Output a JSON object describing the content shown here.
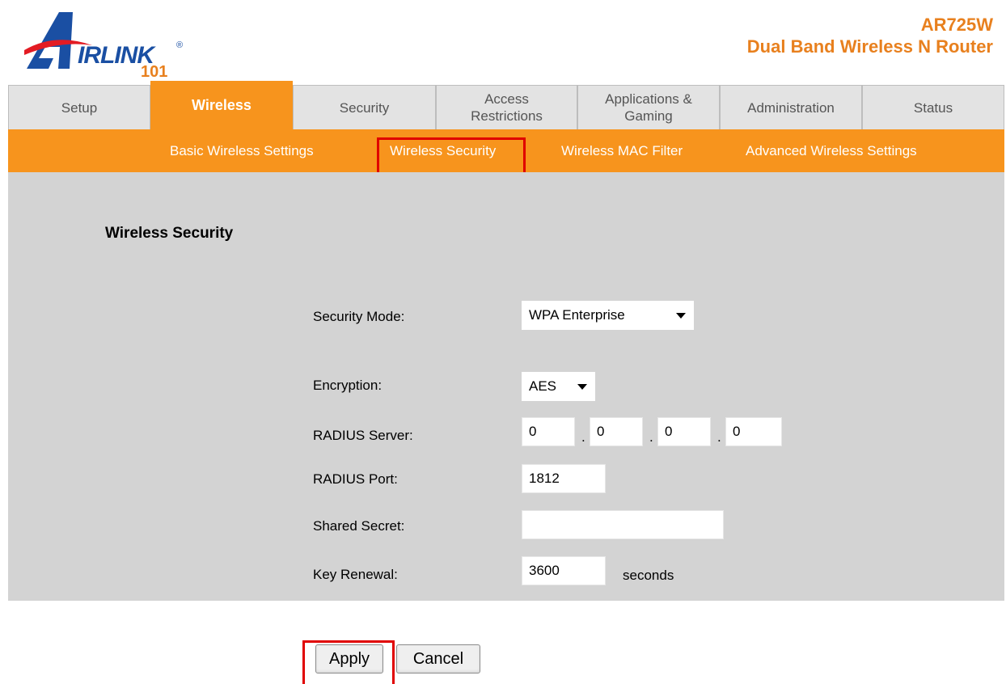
{
  "header": {
    "logo_text": "IRLINK",
    "logo_registered": "®",
    "logo_number": "101",
    "model": "AR725W",
    "model_description": "Dual Band Wireless N Router"
  },
  "tabs": [
    {
      "label": "Setup"
    },
    {
      "label": "Wireless",
      "active": true
    },
    {
      "label": "Security"
    },
    {
      "label_line1": "Access",
      "label_line2": "Restrictions"
    },
    {
      "label_line1": "Applications &",
      "label_line2": "Gaming"
    },
    {
      "label": "Administration"
    },
    {
      "label": "Status"
    }
  ],
  "subnav": {
    "items": [
      {
        "label": "Basic Wireless Settings"
      },
      {
        "label": "Wireless Security",
        "selected": true
      },
      {
        "label": "Wireless MAC Filter"
      },
      {
        "label": "Advanced Wireless Settings"
      }
    ]
  },
  "section": {
    "title": "Wireless Security"
  },
  "form": {
    "security_mode": {
      "label": "Security Mode:",
      "value": "WPA Enterprise"
    },
    "encryption": {
      "label": "Encryption:",
      "value": "AES"
    },
    "radius_server": {
      "label": "RADIUS Server:",
      "octets": [
        "0",
        "0",
        "0",
        "0"
      ],
      "separator": "."
    },
    "radius_port": {
      "label": "RADIUS Port:",
      "value": "1812"
    },
    "shared_secret": {
      "label": "Shared Secret:",
      "value": ""
    },
    "key_renewal": {
      "label": "Key Renewal:",
      "value": "3600",
      "unit": "seconds"
    }
  },
  "buttons": {
    "apply": "Apply",
    "cancel": "Cancel"
  },
  "colors": {
    "accent_orange": "#f7941d",
    "logo_blue": "#1a4fa3",
    "highlight_red": "#e00000",
    "content_gray": "#d3d3d3"
  }
}
